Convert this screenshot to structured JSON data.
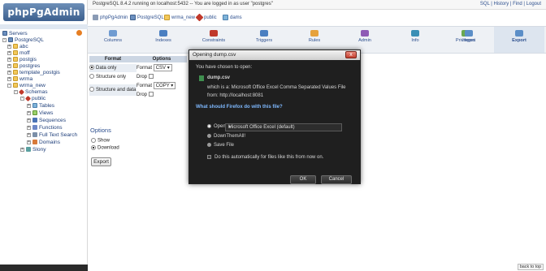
{
  "app": {
    "logo": "phpPgAdmin",
    "status_line": "PostgreSQL 8.4.2 running on localhost:5432 -- You are logged in as user \"postgres\"",
    "top_links": "SQL | History | Find | Logout"
  },
  "tree": {
    "servers": "Servers",
    "items": [
      "PostgreSQL",
      "abc",
      "moff",
      "postgis",
      "postgres",
      "template_postgis",
      "wrma",
      "wrma_new",
      "Schemas",
      "public",
      "Tables",
      "Views",
      "Sequences",
      "Functions",
      "Full Text Search",
      "Domains",
      "Slony"
    ]
  },
  "breadcrumb": [
    "phpPgAdmin",
    "PostgreSQL",
    "wrma_new",
    "public",
    "dams"
  ],
  "tabs": [
    "Columns",
    "Indexes",
    "Constraints",
    "Triggers",
    "Rules",
    "Admin",
    "Info",
    "Privileges",
    "Import",
    "Export"
  ],
  "export_form": {
    "col_format": "Format",
    "col_options": "Options",
    "row_data_only": "Data only",
    "row_structure_only": "Structure only",
    "row_structure_and_data": "Structure and data",
    "format_label": "Format",
    "format_data_value": "CSV",
    "format_struct_value": "COPY",
    "drop_label": "Drop",
    "options_title": "Options",
    "show_label": "Show",
    "download_label": "Download",
    "export_button": "Export"
  },
  "dialog": {
    "title": "Opening dump.csv",
    "intro": "You have chosen to open:",
    "filename": "dump.csv",
    "which_is": "which is a:  Microsoft Office Excel Comma Separated Values File",
    "from": "from:  http://localhost:8081",
    "question": "What should Firefox do with this file?",
    "open_with_label": "Open with",
    "open_with_app": "Microsoft Office Excel (default)",
    "download_them_all": "DownThemAll!",
    "save_file": "Save File",
    "auto_text": "Do this automatically for files like this from now on.",
    "ok": "OK",
    "cancel": "Cancel"
  },
  "footer": {
    "back_to_top": "back to top"
  },
  "colors": {
    "accent": "#2d4f8e",
    "dialog_bg": "#1f1f1f"
  }
}
